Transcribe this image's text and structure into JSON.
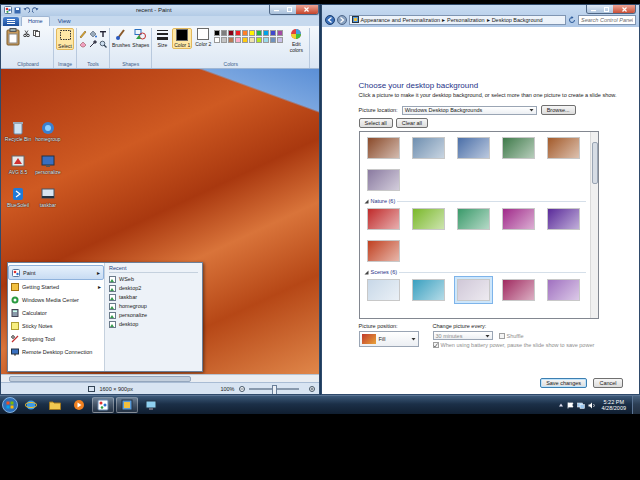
{
  "paint": {
    "title": "recent - Paint",
    "tabs": [
      {
        "label": "Home",
        "selected": true
      },
      {
        "label": "View",
        "selected": false
      }
    ],
    "groups": [
      {
        "label": "Clipboard",
        "buttons": []
      },
      {
        "label": "Image",
        "buttons": [
          {
            "label": "Select",
            "selected": true
          }
        ]
      },
      {
        "label": "Tools",
        "buttons": []
      },
      {
        "label": "Shapes",
        "buttons": [
          {
            "label": "Brushes",
            "selected": false
          },
          {
            "label": "Shapes",
            "selected": false
          }
        ]
      },
      {
        "label": "Colors",
        "buttons": [
          {
            "label": "Size",
            "selected": false
          },
          {
            "label": "Color 1",
            "selected": true,
            "color": "#000000"
          },
          {
            "label": "Color 2",
            "selected": false,
            "color": "#ffffff"
          }
        ]
      }
    ],
    "palette": [
      "#000000",
      "#7f7f7f",
      "#880015",
      "#ed1c24",
      "#ff7f27",
      "#fff200",
      "#22b14c",
      "#00a2e8",
      "#3f48cc",
      "#a349a4",
      "#ffffff",
      "#c3c3c3",
      "#b97a57",
      "#ffaec9",
      "#ffc90e",
      "#efe4b0",
      "#b5e61d",
      "#99d9ea",
      "#7092be",
      "#c8bfe7"
    ],
    "edit_colors": "Edit colors",
    "desktop_icons": [
      {
        "label": "Recycle Bin"
      },
      {
        "label": "homegroup"
      },
      {
        "label": "AVG 8.5"
      },
      {
        "label": "personalize"
      },
      {
        "label": "BlueSoleil"
      },
      {
        "label": "taskbar"
      }
    ],
    "start_menu": {
      "items": [
        {
          "label": "Paint",
          "arrow": "▸",
          "selected": true
        },
        {
          "label": "Getting Started",
          "arrow": "▸",
          "selected": false
        },
        {
          "label": "Windows Media Center",
          "selected": false
        },
        {
          "label": "Calculator",
          "selected": false
        },
        {
          "label": "Sticky Notes",
          "selected": false
        },
        {
          "label": "Snipping Tool",
          "selected": false
        },
        {
          "label": "Remote Desktop Connection",
          "selected": false
        }
      ],
      "recent_header": "Recent",
      "recent": [
        "WSeb",
        "desktop2",
        "taskbar",
        "homegroup",
        "personalize",
        "desktop"
      ]
    },
    "status": {
      "size": "1600 × 900px",
      "zoom": "100%",
      "zoom_level": 0.5
    }
  },
  "control_panel": {
    "breadcrumbs": [
      "Appearance and Personalization",
      "Personalization",
      "Desktop Background"
    ],
    "sep": "▸",
    "search": {
      "placeholder": "Search Control Panel"
    },
    "heading": "Choose your desktop background",
    "description": "Click a picture to make it your desktop background, or select more than one picture to create a slide show.",
    "location_label": "Picture location:",
    "location_value": "Windows Desktop Backgrounds",
    "browse": "Browse...",
    "select_all": "Select all",
    "clear_all": "Clear all",
    "thumb_groups": [
      {
        "thumbs": [
          {
            "color": "#8a4a2a",
            "selected": false
          },
          {
            "color": "#6f8fb0",
            "selected": false
          },
          {
            "color": "#4b6fa8",
            "selected": false
          },
          {
            "color": "#3f7a4a",
            "selected": false
          },
          {
            "color": "#a35a2a",
            "selected": false
          },
          {
            "color": "#8a7aa0",
            "selected": false
          }
        ]
      },
      {
        "header": "Nature (6)",
        "thumbs": [
          {
            "color": "#c02a2a",
            "selected": false
          },
          {
            "color": "#7ab82a",
            "selected": false
          },
          {
            "color": "#3a9a6a",
            "selected": false
          },
          {
            "color": "#a02a8a",
            "selected": false
          },
          {
            "color": "#5a2a9a",
            "selected": false
          },
          {
            "color": "#c04020",
            "selected": false
          }
        ]
      },
      {
        "header": "Scenes (6)",
        "thumbs": [
          {
            "color": "#c8d8e8",
            "selected": false
          },
          {
            "color": "#3aa0c0",
            "selected": false
          },
          {
            "color": "#d0c8d8",
            "selected": true
          },
          {
            "color": "#a02a60",
            "selected": false
          },
          {
            "color": "#a070c0",
            "selected": false
          }
        ]
      }
    ],
    "position_label": "Picture position:",
    "position_value": "Fill",
    "interval_label": "Change picture every:",
    "interval_value": "30 minutes",
    "interval_disabled": true,
    "shuffle": {
      "label": "Shuffle",
      "checked": false,
      "disabled": true
    },
    "battery": {
      "label": "When using battery power, pause the slide show to save power",
      "checked": true,
      "disabled": true
    },
    "buttons": [
      {
        "label": "Save changes",
        "default": true
      },
      {
        "label": "Cancel",
        "default": false
      }
    ]
  },
  "taskbar": {
    "time": "5:22 PM",
    "date": "4/28/2009"
  }
}
